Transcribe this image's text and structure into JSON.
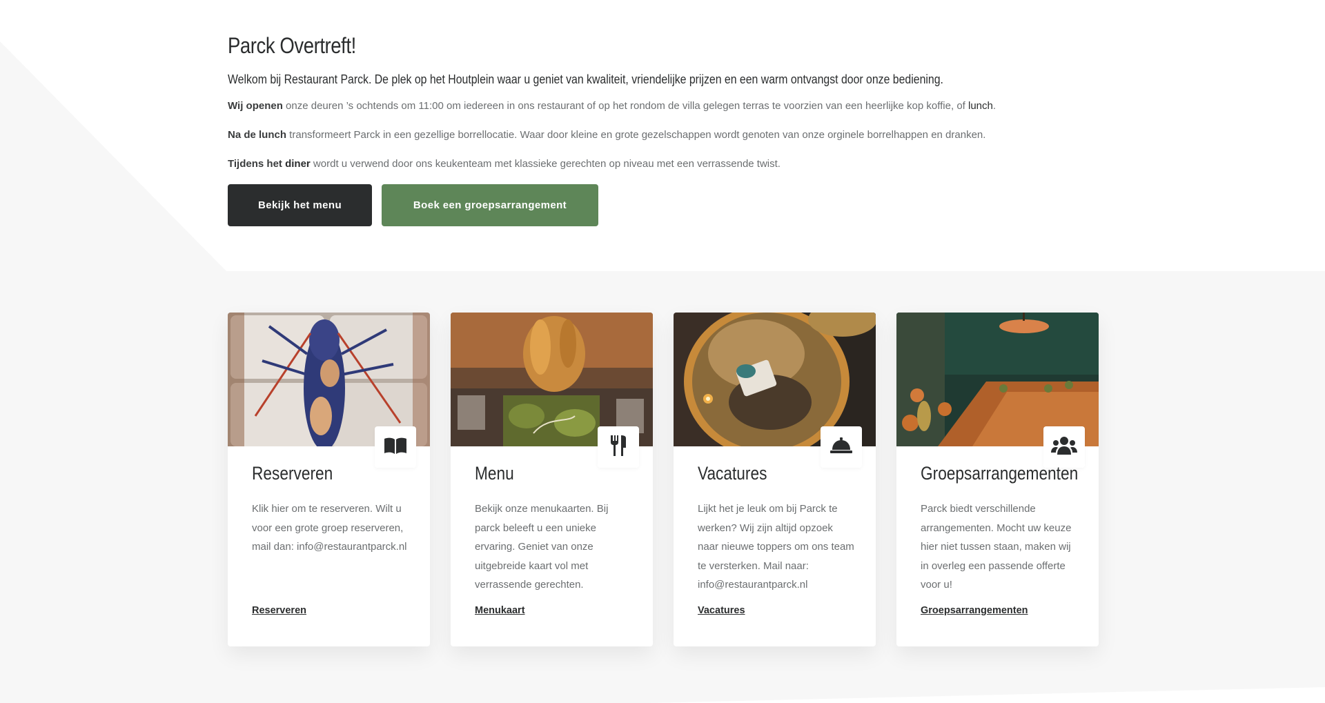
{
  "intro": {
    "title": "Parck Overtreft!",
    "lead": "Welkom bij Restaurant Parck. De plek op het Houtplein waar u geniet van kwaliteit, vriendelijke prijzen en een warm ontvangst door onze bediening.",
    "p1_bold": "Wij openen",
    "p1_text": " onze deuren ’s ochtends om 11:00 om iedereen in ons restaurant of op het rondom de villa gelegen terras te voorzien van een heerlijke kop koffie, of ",
    "p1_link": "lunch",
    "p1_end": ".",
    "p2_bold": "Na de lunch",
    "p2_text": " transformeert Parck in een gezellige borrellocatie. Waar door kleine en grote gezelschappen wordt genoten van onze orginele borrelhappen en dranken.",
    "p3_bold1": "Tijdens het",
    "p3_bold2": "diner",
    "p3_text": " wordt u verwend door ons keukenteam met klassieke gerechten op niveau met een verrassende twist."
  },
  "buttons": {
    "menu": "Bekijk het menu",
    "group": "Boek een groepsarrangement"
  },
  "colors": {
    "dark": "#2b2d2e",
    "green": "#5e8658",
    "text_muted": "#6b6e70",
    "bg_light": "#f7f7f7"
  },
  "cards": [
    {
      "title": "Reserveren",
      "text": "Klik hier om te reserveren. Wilt u voor een grote groep reserveren, mail dan: info@restaurantparck.nl",
      "link": "Reserveren",
      "icon": "book-icon"
    },
    {
      "title": "Menu",
      "text": "Bekijk onze menukaarten. Bij parck beleeft u een unieke ervaring. Geniet van onze uitgebreide kaart vol met verrassende gerechten.",
      "link": "Menukaart",
      "icon": "utensils-icon"
    },
    {
      "title": "Vacatures",
      "text": "Lijkt het je leuk om bij Parck te werken? Wij zijn altijd opzoek naar nieuwe toppers om ons team te versterken. Mail naar: info@restaurantparck.nl",
      "link": "Vacatures",
      "icon": "service-bell-icon"
    },
    {
      "title": "Groepsarrangementen",
      "text": "Parck biedt verschillende arrangementen. Mocht uw keuze hier niet tussen staan, maken wij in overleg een passende offerte voor u!",
      "link": "Groepsarrangementen",
      "icon": "users-icon"
    }
  ]
}
